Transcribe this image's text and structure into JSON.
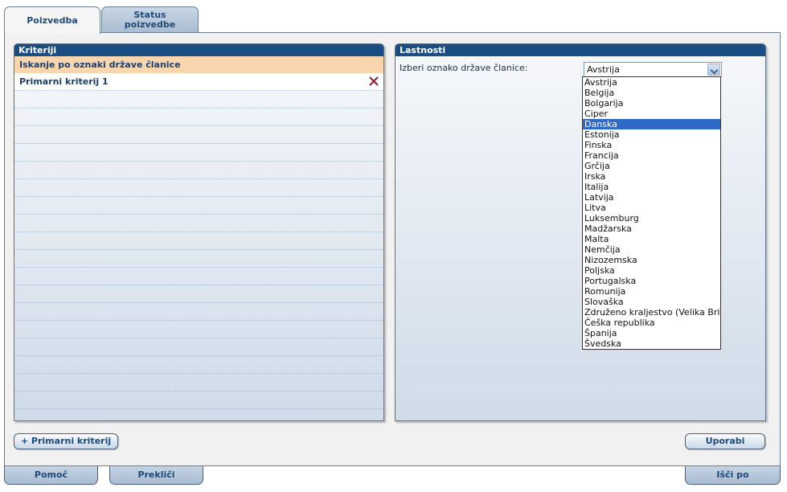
{
  "tabs": {
    "search": "Poizvedba",
    "status_line1": "Status",
    "status_line2": "poizvedbe"
  },
  "criteria_panel": {
    "title": "Kriteriji",
    "header_row": "Iskanje po oznaki države članice",
    "criteria": [
      "Primarni kriterij 1"
    ],
    "empty_rows": 19
  },
  "properties_panel": {
    "title": "Lastnosti",
    "label": "Izberi oznako države članice:",
    "selected_value": "Avstrija"
  },
  "dropdown_options": [
    "Avstrija",
    "Belgija",
    "Bolgarija",
    "Ciper",
    "Danska",
    "Estonija",
    "Finska",
    "Francija",
    "Grčija",
    "Irska",
    "Italija",
    "Latvija",
    "Litva",
    "Luksemburg",
    "Madžarska",
    "Malta",
    "Nemčija",
    "Nizozemska",
    "Poljska",
    "Portugalska",
    "Romunija",
    "Slovaška",
    "Združeno kraljestvo (Velika Britanija)",
    "Češka republika",
    "Španija",
    "Švedska"
  ],
  "highlighted_option": "Danska",
  "buttons": {
    "add_criteria": "+ Primarni kriterij",
    "apply": "Uporabi"
  },
  "bottom": {
    "help": "Pomoč",
    "cancel": "Prekliči",
    "search": "Išči po"
  },
  "colors": {
    "header": "#1a4e82",
    "highlight_row": "#f9d6ad",
    "selected_option": "#316ac5",
    "delete_icon": "#8b1a2a"
  },
  "icons": {
    "delete": "close-icon",
    "dropdown": "chevron-down-icon"
  }
}
